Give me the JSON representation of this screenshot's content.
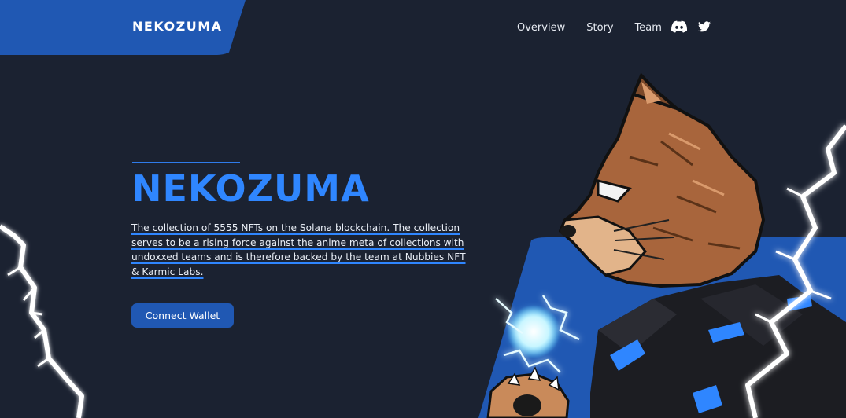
{
  "header": {
    "brand": "NEKOZUMA",
    "nav": [
      {
        "label": "Overview"
      },
      {
        "label": "Story"
      },
      {
        "label": "Team"
      }
    ],
    "social": [
      {
        "icon": "discord-icon"
      },
      {
        "icon": "twitter-icon"
      }
    ]
  },
  "hero": {
    "title": "NEKOZUMA",
    "description": "The collection  of 5555 NFTs on the Solana blockchain. The collection serves to be a rising force against the anime meta of collections with undoxxed teams and is therefore backed by the team at Nubbies NFT & Karmic Labs.",
    "cta_label": "Connect Wallet"
  },
  "colors": {
    "background": "#1b2231",
    "accent": "#2058b3",
    "title_blue": "#2f86ff"
  }
}
